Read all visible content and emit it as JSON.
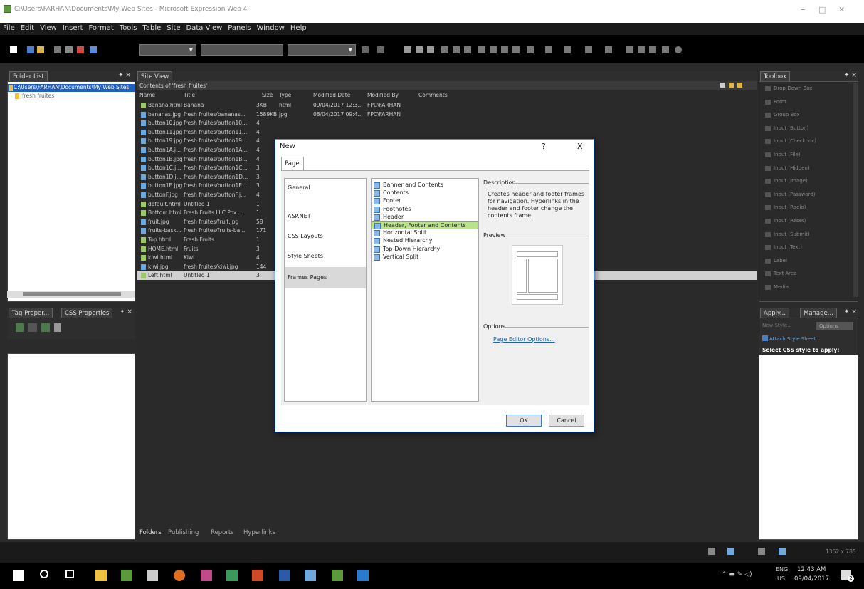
{
  "window": {
    "title": "C:\\Users\\FARHAN\\Documents\\My Web Sites - Microsoft Expression Web 4",
    "min": "–",
    "max": "□",
    "close": "✕"
  },
  "menu": [
    "File",
    "Edit",
    "View",
    "Insert",
    "Format",
    "Tools",
    "Table",
    "Site",
    "Data View",
    "Panels",
    "Window",
    "Help"
  ],
  "folder_list": {
    "tab": "Folder List",
    "path": "C:\\Users\\FARHAN\\Documents\\My Web Sites",
    "item": "fresh fruites"
  },
  "tag_panel": {
    "tab1": "Tag Proper...",
    "tab2": "CSS Properties"
  },
  "site_view": {
    "tab": "Site View",
    "contents_label": "Contents of 'fresh fruites'",
    "columns": [
      "Name",
      "Title",
      "Size",
      "Type",
      "Modified Date",
      "Modified By",
      "Comments"
    ],
    "rows": [
      {
        "name": "Banana.html",
        "title": "Banana",
        "size": "3KB",
        "type": "html",
        "date": "09/04/2017 12:3...",
        "by": "FPC\\FARHAN"
      },
      {
        "name": "bananas.jpg",
        "title": "fresh fruites/bananas...",
        "size": "1589KB",
        "type": "jpg",
        "date": "08/04/2017 09:4...",
        "by": "FPC\\FARHAN"
      },
      {
        "name": "button10.jpg",
        "title": "fresh fruites/button10...",
        "size": "4",
        "type": "",
        "date": "",
        "by": ""
      },
      {
        "name": "button11.jpg",
        "title": "fresh fruites/button11...",
        "size": "4",
        "type": "",
        "date": "",
        "by": ""
      },
      {
        "name": "button19.jpg",
        "title": "fresh fruites/button19...",
        "size": "4",
        "type": "",
        "date": "",
        "by": ""
      },
      {
        "name": "button1A.j...",
        "title": "fresh fruites/button1A...",
        "size": "4",
        "type": "",
        "date": "",
        "by": ""
      },
      {
        "name": "button1B.jpg",
        "title": "fresh fruites/button1B...",
        "size": "4",
        "type": "",
        "date": "",
        "by": ""
      },
      {
        "name": "button1C.j...",
        "title": "fresh fruites/button1C...",
        "size": "3",
        "type": "",
        "date": "",
        "by": ""
      },
      {
        "name": "button1D.j...",
        "title": "fresh fruites/button1D...",
        "size": "3",
        "type": "",
        "date": "",
        "by": ""
      },
      {
        "name": "button1E.jpg",
        "title": "fresh fruites/button1E...",
        "size": "3",
        "type": "",
        "date": "",
        "by": ""
      },
      {
        "name": "buttonF.jpg",
        "title": "fresh fruites/buttonF.j...",
        "size": "4",
        "type": "",
        "date": "",
        "by": ""
      },
      {
        "name": "default.html",
        "title": "Untitled 1",
        "size": "1",
        "type": "",
        "date": "",
        "by": ""
      },
      {
        "name": "Bottom.html",
        "title": "Fresh Fruits LLC Pox ...",
        "size": "1",
        "type": "",
        "date": "",
        "by": ""
      },
      {
        "name": "fruit.jpg",
        "title": "fresh fruites/fruit.jpg",
        "size": "58",
        "type": "",
        "date": "",
        "by": ""
      },
      {
        "name": "fruits-bask...",
        "title": "fresh fruites/fruits-ba...",
        "size": "171",
        "type": "",
        "date": "",
        "by": ""
      },
      {
        "name": "Top.html",
        "title": "Fresh Fruits",
        "size": "1",
        "type": "",
        "date": "",
        "by": ""
      },
      {
        "name": "HOME.html",
        "title": "Fruits",
        "size": "3",
        "type": "",
        "date": "",
        "by": ""
      },
      {
        "name": "kiwi.html",
        "title": "Kiwi",
        "size": "4",
        "type": "",
        "date": "",
        "by": ""
      },
      {
        "name": "kiwi.jpg",
        "title": "fresh fruites/kiwi.jpg",
        "size": "144",
        "type": "",
        "date": "",
        "by": ""
      },
      {
        "name": "Left.html",
        "title": "Untitled 1",
        "size": "3",
        "type": "",
        "date": "",
        "by": ""
      }
    ],
    "bottom_tabs": [
      "Folders",
      "Publishing",
      "Reports",
      "Hyperlinks"
    ]
  },
  "dialog": {
    "title": "New",
    "help": "?",
    "close": "X",
    "tab": "Page",
    "categories": [
      "General",
      "ASP.NET",
      "CSS Layouts",
      "Style Sheets",
      "Frames Pages"
    ],
    "selected_category": "Frames Pages",
    "templates": [
      "Banner and Contents",
      "Contents",
      "Footer",
      "Footnotes",
      "Header",
      "Header, Footer and Contents",
      "Horizontal Split",
      "Nested Hierarchy",
      "Top-Down Hierarchy",
      "Vertical Split"
    ],
    "selected_template": "Header, Footer and Contents",
    "description_label": "Description",
    "description_text": "Creates header and footer frames for navigation. Hyperlinks in the header and footer change the contents frame.",
    "preview_label": "Preview",
    "options_label": "Options",
    "options_link": "Page Editor Options...",
    "ok": "OK",
    "cancel": "Cancel"
  },
  "toolbox": {
    "tab": "Toolbox",
    "items": [
      "Drop-Down Box",
      "Form",
      "Group Box",
      "Input (Button)",
      "Input (Checkbox)",
      "Input (File)",
      "Input (Hidden)",
      "Input (Image)",
      "Input (Password)",
      "Input (Radio)",
      "Input (Reset)",
      "Input (Submit)",
      "Input (Text)",
      "Label",
      "Text Area",
      "Media"
    ]
  },
  "apply_panel": {
    "tab1": "Apply...",
    "tab2": "Manage...",
    "new_style": "New Style...",
    "options": "Options",
    "attach": "Attach Style Sheet...",
    "select_label": "Select CSS style to apply:"
  },
  "status": {
    "resolution": "1362 x 785"
  },
  "taskbar": {
    "lang1": "ENG",
    "lang2": "US",
    "time": "12:43 AM",
    "date": "09/04/2017",
    "notif": "2"
  }
}
